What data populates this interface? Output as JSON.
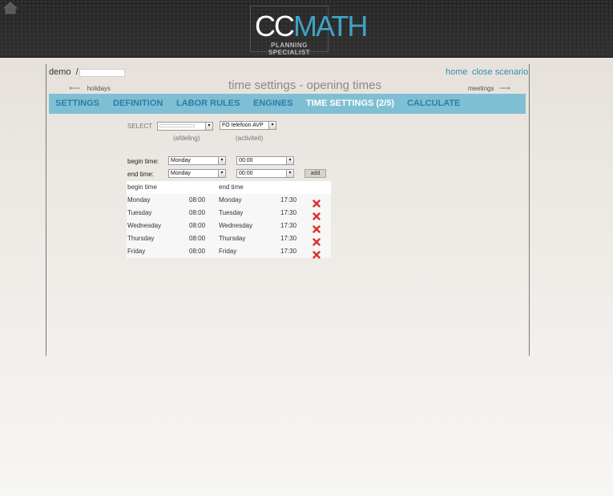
{
  "header": {
    "logo_word_cc": "CC",
    "logo_word_math": "MATH",
    "logo_tagline": "PLANNING SPECIALIST",
    "home_icon": "house-icon"
  },
  "breadcrumb": {
    "root": "demo",
    "separator": "/",
    "scenario_value": ""
  },
  "top_links": {
    "home": "home",
    "close": "close scenario"
  },
  "page": {
    "title": "time settings - opening times",
    "prev_label": "holidays",
    "next_label": "meetings",
    "prev_arrow": "⟵",
    "next_arrow": "⟶"
  },
  "tabs": [
    {
      "label": "SETTINGS",
      "active": false
    },
    {
      "label": "DEFINITION",
      "active": false
    },
    {
      "label": "LABOR RULES",
      "active": false
    },
    {
      "label": "ENGINES",
      "active": false
    },
    {
      "label": "TIME SETTINGS (2/5)",
      "active": true
    },
    {
      "label": "CALCULATE",
      "active": false
    }
  ],
  "filters": {
    "select_label": "SELECT",
    "department_value": "",
    "department_caption": "(afdeling)",
    "activity_value": "FO telefoon AVP",
    "activity_caption": "(activiteit)"
  },
  "form": {
    "begin_label": "begin time:",
    "end_label": "end time:",
    "begin_day": "Monday",
    "begin_time": "00:00",
    "end_day": "Monday",
    "end_time": "00:00",
    "add_label": "add",
    "dropdown_glyph": "▾"
  },
  "table": {
    "headers": {
      "begin": "begin time",
      "end": "end time"
    },
    "rows": [
      {
        "begin_day": "Monday",
        "begin_time": "08:00",
        "end_day": "Monday",
        "end_time": "17:30"
      },
      {
        "begin_day": "Tuesday",
        "begin_time": "08:00",
        "end_day": "Tuesday",
        "end_time": "17:30"
      },
      {
        "begin_day": "Wednesday",
        "begin_time": "08:00",
        "end_day": "Wednesday",
        "end_time": "17:30"
      },
      {
        "begin_day": "Thursday",
        "begin_time": "08:00",
        "end_day": "Thursday",
        "end_time": "17:30"
      },
      {
        "begin_day": "Friday",
        "begin_time": "08:00",
        "end_day": "Friday",
        "end_time": "17:30"
      }
    ],
    "delete_icon": "delete-x-icon"
  },
  "colors": {
    "accent": "#3a8cb5",
    "tabbar": "#7fbfd4",
    "delete": "#d9302b"
  }
}
